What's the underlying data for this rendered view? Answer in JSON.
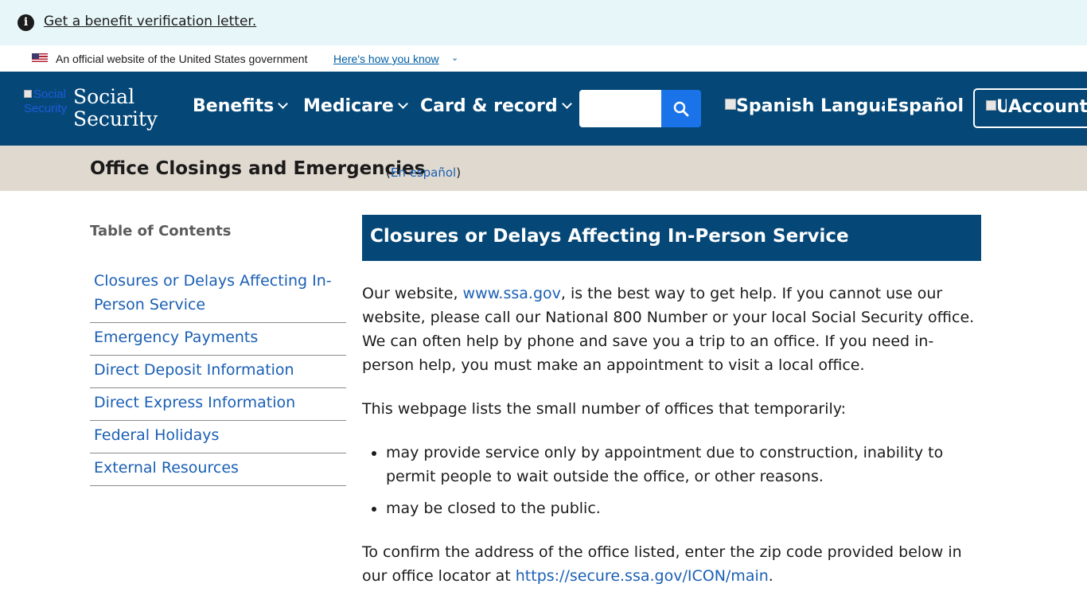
{
  "alert": {
    "icon": "info-icon",
    "link": "Get a benefit verification letter."
  },
  "gov_banner": {
    "text": "An official website of the United States government",
    "link": "Here's how you know"
  },
  "header": {
    "logo_alt": "Social Security",
    "logo_line1": "Social",
    "logo_line2": "Security",
    "nav": [
      {
        "label": "Benefits"
      },
      {
        "label": "Medicare"
      },
      {
        "label": "Card & record"
      }
    ],
    "search_placeholder": "",
    "language_alt": "Spanish Language",
    "language_label": "Español",
    "account_alt": "User",
    "account_label": "Account",
    "colors": {
      "header_bg": "#054878",
      "search_button": "#1a73e8"
    }
  },
  "page": {
    "title": "Office Closings and Emergencies",
    "alt_prefix": "(",
    "alt_link": "En español",
    "alt_suffix": ")"
  },
  "toc": {
    "heading": "Table of Contents",
    "items": [
      "Closures or Delays Affecting In-Person Service",
      "Emergency Payments",
      "Direct Deposit Information",
      "Direct Express Information",
      "Federal Holidays",
      "External Resources"
    ]
  },
  "main": {
    "section_title": "Closures or Delays Affecting In-Person Service",
    "p1_before": "Our website, ",
    "p1_link": "www.ssa.gov",
    "p1_after": ", is the best way to get help. If you cannot use our website, please call our National 800 Number or your local Social Security office. We can often help by phone and save you a trip to an office. If you need in-person help, you must make an appointment to visit a local office.",
    "p2": "This webpage lists the small number of offices that temporarily:",
    "bullets": [
      "may provide service only by appointment due to construction, inability to permit people to wait outside the office, or other reasons.",
      "may be closed to the public."
    ],
    "p3_before": "To confirm the address of the office listed, enter the zip code provided below in our office locator at ",
    "p3_link": "https://secure.ssa.gov/ICON/main",
    "p3_after": "."
  }
}
